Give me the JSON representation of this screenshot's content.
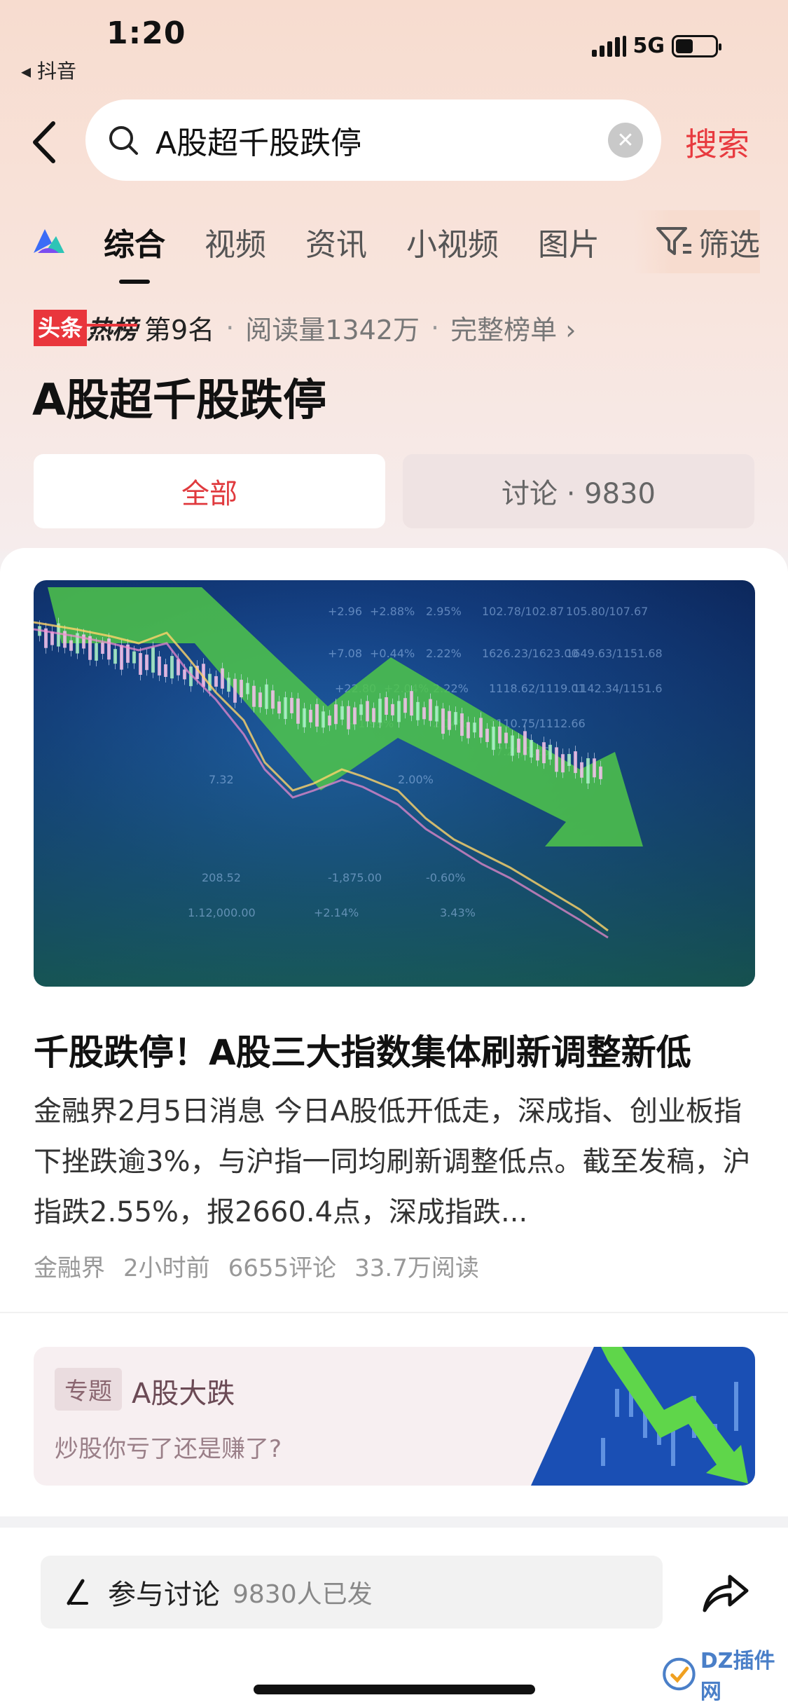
{
  "status_bar": {
    "time": "1:20",
    "back_app": "◂ 抖音",
    "network": "5G"
  },
  "search": {
    "query": "A股超千股跌停",
    "action_label": "搜索"
  },
  "tabs": [
    {
      "label": "综合",
      "active": true
    },
    {
      "label": "视频"
    },
    {
      "label": "资讯"
    },
    {
      "label": "小视频"
    },
    {
      "label": "图片"
    }
  ],
  "filter_label": "筛选",
  "hot": {
    "badge_left": "头条",
    "badge_right": "热榜",
    "rank": "第9名",
    "reads": "阅读量1342万",
    "full_list": "完整榜单 ›"
  },
  "topic_title": "A股超千股跌停",
  "segments": {
    "all": "全部",
    "discuss": "讨论 · 9830"
  },
  "article": {
    "title": "千股跌停！A股三大指数集体刷新调整新低",
    "summary": "金融界2月5日消息 今日A股低开低走，深成指、创业板指下挫跌逾3%，与沪指一同均刷新调整低点。截至发稿，沪指跌2.55%，报2660.4点，深成指跌...",
    "source": "金融界",
    "time": "2小时前",
    "comments": "6655评论",
    "reads": "33.7万阅读"
  },
  "special": {
    "tag": "专题",
    "name": "A股大跌",
    "subtitle": "炒股你亏了还是赚了?"
  },
  "bottom": {
    "discuss_label": "参与讨论",
    "discuss_count": "9830人已发"
  },
  "watermark": "DZ插件网",
  "colors": {
    "accent": "#e83a3f",
    "background_top": "#f7dccf"
  }
}
